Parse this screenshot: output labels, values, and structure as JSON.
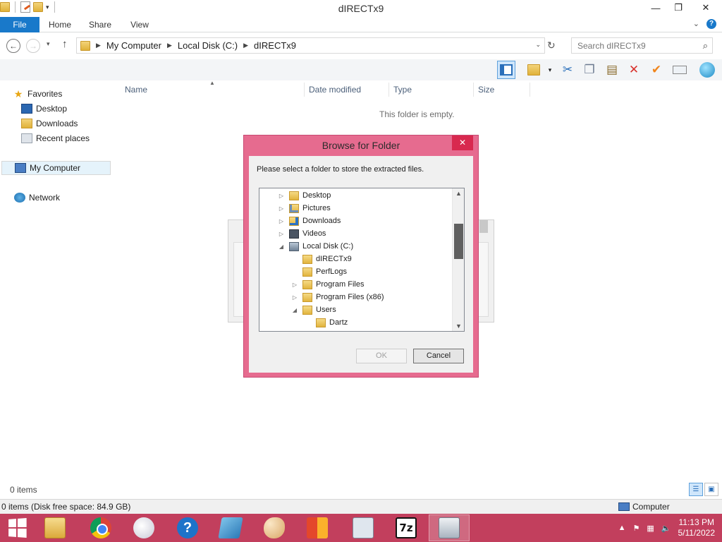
{
  "window": {
    "title": "dIRECTx9",
    "minimize": "—",
    "maximize": "❐",
    "close": "✕"
  },
  "ribbon": {
    "tabs": [
      "File",
      "Home",
      "Share",
      "View"
    ],
    "expand": "⌄",
    "help": "?"
  },
  "address": {
    "crumbs": [
      "My Computer",
      "Local Disk (C:)",
      "dIRECTx9"
    ],
    "search_placeholder": "Search dIRECTx9"
  },
  "nav": {
    "favorites_label": "Favorites",
    "favorites": [
      "Desktop",
      "Downloads",
      "Recent places"
    ],
    "computer": "My Computer",
    "network": "Network"
  },
  "columns": [
    "Name",
    "Date modified",
    "Type",
    "Size"
  ],
  "empty_message": "This folder is empty.",
  "dialog": {
    "title": "Browse for Folder",
    "prompt": "Please select a folder to store the extracted files.",
    "tree": [
      {
        "label": "Desktop",
        "expander": "▷",
        "icon": "desktop-folder-icon"
      },
      {
        "label": "Pictures",
        "expander": "▷",
        "icon": "pictures-folder-icon"
      },
      {
        "label": "Downloads",
        "expander": "▷",
        "icon": "downloads-folder-icon"
      },
      {
        "label": "Videos",
        "expander": "▷",
        "icon": "videos-folder-icon"
      },
      {
        "label": "Local Disk (C:)",
        "expander": "◢",
        "icon": "local-disk-icon"
      },
      {
        "label": "dIRECTx9",
        "expander": "",
        "icon": "folder-icon"
      },
      {
        "label": "PerfLogs",
        "expander": "",
        "icon": "folder-icon"
      },
      {
        "label": "Program Files",
        "expander": "▷",
        "icon": "folder-icon"
      },
      {
        "label": "Program Files (x86)",
        "expander": "▷",
        "icon": "folder-icon"
      },
      {
        "label": "Users",
        "expander": "◢",
        "icon": "folder-icon"
      },
      {
        "label": "Dartz",
        "expander": "",
        "icon": "folder-icon"
      }
    ],
    "ok_label": "OK",
    "cancel_label": "Cancel"
  },
  "status": {
    "items": "0 items",
    "disk": "0 items (Disk free space: 84.9 GB)",
    "location": "Computer"
  },
  "taskbar": {
    "clock_time": "11:13 PM",
    "clock_date": "5/11/2022",
    "sevenzip": "7z"
  },
  "colors": {
    "dialog_frame": "#e66b8f",
    "taskbar": "#c23f5d",
    "file_tab": "#1979ca"
  }
}
